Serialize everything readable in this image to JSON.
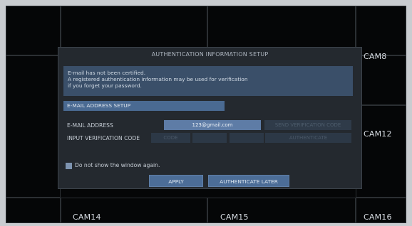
{
  "cameras": {
    "cam8": "CAM8",
    "cam12": "CAM12",
    "cam14": "CAM14",
    "cam15": "CAM15",
    "cam16": "CAM16"
  },
  "dialog": {
    "title": "AUTHENTICATION INFORMATION SETUP",
    "info_lines": [
      "E-mail has not been certified.",
      "A registered authentication information may be used for verification",
      "if you forget your password."
    ],
    "section_header": "E-MAIL ADDRESS SETUP",
    "email_label": "E-MAIL ADDRESS",
    "email_value": "123@gmail.com",
    "send_code_label": "SEND VERIFICATION CODE",
    "verification_label": "INPUT VERIFICATION CODE",
    "code_placeholders": [
      "CODE",
      "",
      ""
    ],
    "authenticate_label": "AUTHENTICATE",
    "checkbox_label": "Do not show the window again.",
    "checkbox_checked": false,
    "apply_label": "APPLY",
    "later_label": "AUTHENTICATE LATER"
  },
  "colors": {
    "screen_bg": "#050607",
    "dialog_bg": "#24292f",
    "accent": "#4c6d97",
    "info_bg": "#3a4f69"
  }
}
